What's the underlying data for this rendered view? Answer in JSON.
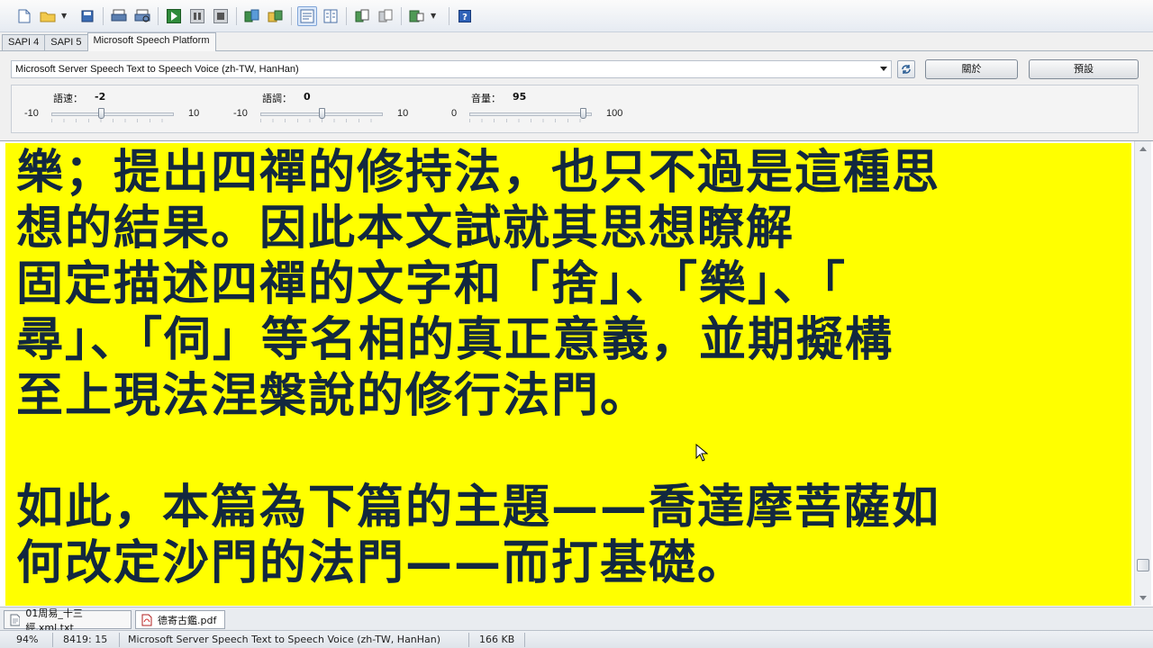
{
  "tabs": [
    "SAPI 4",
    "SAPI 5",
    "Microsoft Speech Platform"
  ],
  "voice": {
    "selected": "Microsoft Server Speech Text to Speech Voice (zh-TW, HanHan)"
  },
  "buttons": {
    "about": "關於",
    "default": "預設"
  },
  "sliders": {
    "rate": {
      "label": "語速：",
      "value": "-2",
      "min": "-10",
      "max": "10"
    },
    "pitch": {
      "label": "語調：",
      "value": "0",
      "min": "-10",
      "max": "10"
    },
    "volume": {
      "label": "音量：",
      "value": "95",
      "min": "0",
      "max": "100"
    }
  },
  "editor": {
    "background": "#ffff00",
    "text_color": "#12283f",
    "lines": [
      "樂；提出四禪的修持法，也只不過是這種思",
      "想的結果。因此本文試就其思想瞭解",
      "固定描述四禪的文字和「捨」、「樂」、「",
      "尋」、「伺」等名相的真正意義，並期擬構",
      "至上現法涅槃說的修行法門。",
      "",
      "如此，本篇為下篇的主題——喬達摩菩薩如",
      "何改定沙門的法門——而打基礎。"
    ]
  },
  "documents": [
    "01周易_十三經.xml.txt",
    "德寄古鑑.pdf"
  ],
  "status": {
    "zoom": "94%",
    "position": "8419:  15",
    "voice": "Microsoft Server Speech Text to Speech Voice (zh-TW, HanHan)",
    "size": "166 KB"
  }
}
